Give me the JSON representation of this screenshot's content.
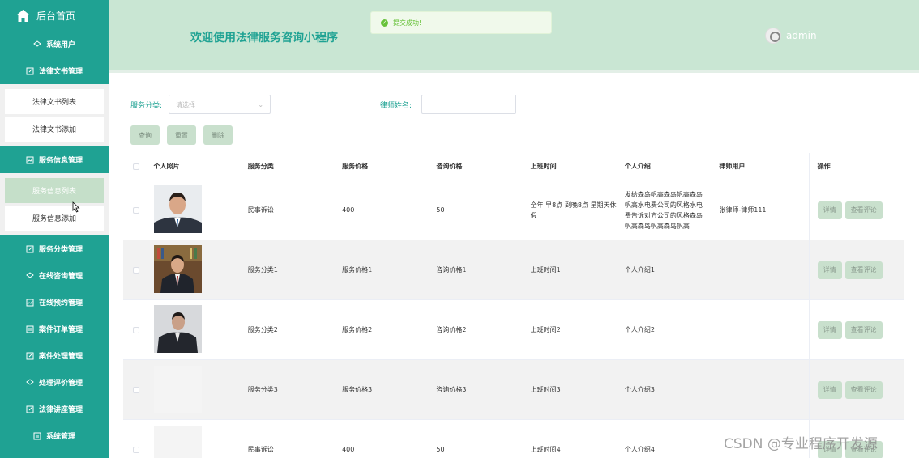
{
  "sidebar": {
    "home": "后台首页",
    "items": [
      {
        "label": "系统用户",
        "icon": "layers-icon"
      },
      {
        "label": "法律文书管理",
        "icon": "edit-icon"
      },
      {
        "label": "法律文书列表",
        "sub": true
      },
      {
        "label": "法律文书添加",
        "sub": true
      },
      {
        "label": "服务信息管理",
        "icon": "chart-icon"
      },
      {
        "label": "服务信息列表",
        "sub": true,
        "active": true
      },
      {
        "label": "服务信息添加",
        "sub": true
      },
      {
        "label": "服务分类管理",
        "icon": "edit-icon"
      },
      {
        "label": "在线咨询管理",
        "icon": "layers-icon"
      },
      {
        "label": "在线预约管理",
        "icon": "chart-icon"
      },
      {
        "label": "案件订单管理",
        "icon": "document-icon"
      },
      {
        "label": "案件处理管理",
        "icon": "edit-icon"
      },
      {
        "label": "处理评价管理",
        "icon": "layers-icon"
      },
      {
        "label": "法律讲座管理",
        "icon": "edit-icon"
      },
      {
        "label": "系统管理",
        "icon": "document-icon"
      }
    ]
  },
  "header": {
    "title": "欢迎使用法律服务咨询小程序",
    "toast": "提交成功!",
    "user": "admin"
  },
  "search": {
    "category_label": "服务分类:",
    "category_placeholder": "请选择",
    "lawyer_label": "律师姓名:",
    "query_button": "查询",
    "reset_button": "重置",
    "delete_button": "删除"
  },
  "table": {
    "headers": {
      "photo": "个人照片",
      "category": "服务分类",
      "price": "服务价格",
      "consult_price": "咨询价格",
      "work_time": "上班时间",
      "intro": "个人介绍",
      "lawyer": "律师用户",
      "actions": "操作"
    },
    "detail_button": "详情",
    "comment_button": "查看评论",
    "rows": [
      {
        "category": "民事诉讼",
        "price": "400",
        "consult_price": "50",
        "work_time": "全年 早8点 到晚8点 星期天休假",
        "intro": "发给森岛帆高森岛帆高森岛帆高水电费公司的风格水电费告诉对方公司的风格森岛帆高森岛帆高森岛帆高",
        "lawyer": "张律师-律师111"
      },
      {
        "category": "服务分类1",
        "price": "服务价格1",
        "consult_price": "咨询价格1",
        "work_time": "上班时间1",
        "intro": "个人介绍1",
        "lawyer": ""
      },
      {
        "category": "服务分类2",
        "price": "服务价格2",
        "consult_price": "咨询价格2",
        "work_time": "上班时间2",
        "intro": "个人介绍2",
        "lawyer": ""
      },
      {
        "category": "服务分类3",
        "price": "服务价格3",
        "consult_price": "咨询价格3",
        "work_time": "上班时间3",
        "intro": "个人介绍3",
        "lawyer": ""
      },
      {
        "category": "民事诉讼",
        "price": "400",
        "consult_price": "50",
        "work_time": "上班时间4",
        "intro": "个人介绍4",
        "lawyer": ""
      }
    ]
  },
  "watermark": "CSDN @专业程序开发源",
  "colors": {
    "accent": "#1fa293",
    "header_bg": "#c9e6d3",
    "button_bg": "#c9e0cd"
  }
}
